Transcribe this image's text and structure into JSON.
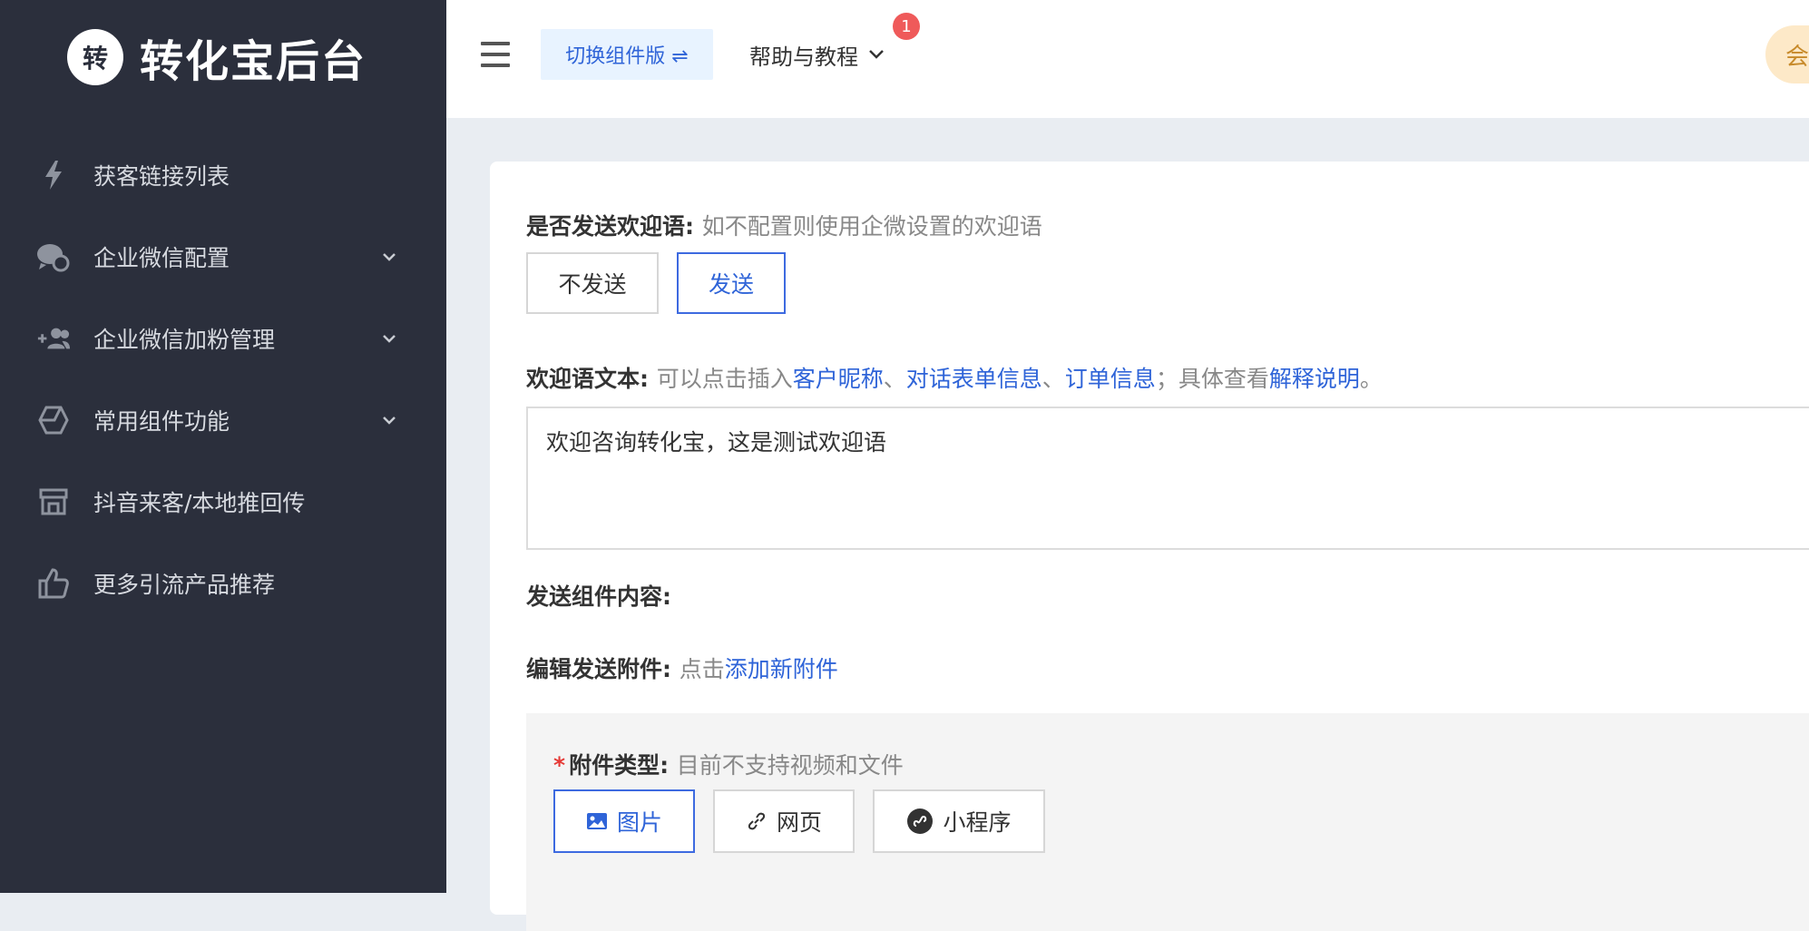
{
  "brand": {
    "logo_char": "转",
    "title": "转化宝后台"
  },
  "sidebar": {
    "items": [
      {
        "label": "获客链接列表",
        "icon": "lightning-icon",
        "has_children": false
      },
      {
        "label": "企业微信配置",
        "icon": "chat-bubbles-icon",
        "has_children": true
      },
      {
        "label": "企业微信加粉管理",
        "icon": "add-user-icon",
        "has_children": true
      },
      {
        "label": "常用组件功能",
        "icon": "hexagon-icon",
        "has_children": true
      },
      {
        "label": "抖音来客/本地推回传",
        "icon": "store-icon",
        "has_children": false
      },
      {
        "label": "更多引流产品推荐",
        "icon": "thumbs-up-icon",
        "has_children": false
      }
    ]
  },
  "topbar": {
    "switch_label": "切换组件版 ⇌",
    "help_label": "帮助与教程",
    "help_badge": "1",
    "avatar_char": "会"
  },
  "form": {
    "welcome_send": {
      "label": "是否发送欢迎语:",
      "hint": "如不配置则使用企微设置的欢迎语",
      "options": [
        "不发送",
        "发送"
      ],
      "selected": "发送"
    },
    "welcome_text": {
      "label": "欢迎语文本:",
      "hint_prefix": "可以点击插入",
      "link_nickname": "客户昵称",
      "sep1": "、",
      "link_form": "对话表单信息",
      "sep2": "、",
      "link_order": "订单信息",
      "hint_mid": "；具体查看",
      "link_explain": "解释说明",
      "hint_end": "。",
      "value": "欢迎咨询转化宝，这是测试欢迎语"
    },
    "component_content": {
      "label": "发送组件内容:"
    },
    "attachments": {
      "label": "编辑发送附件:",
      "hint": "点击",
      "link_add": "添加新附件"
    },
    "attachment_type": {
      "required_mark": "*",
      "label": "附件类型:",
      "hint": "目前不支持视频和文件",
      "options": [
        {
          "label": "图片",
          "icon": "image-icon"
        },
        {
          "label": "网页",
          "icon": "link-icon"
        },
        {
          "label": "小程序",
          "icon": "mini-program-icon"
        }
      ],
      "selected": "图片"
    }
  },
  "colors": {
    "sidebar_bg": "#2b2f3c",
    "accent": "#2f64d8",
    "badge": "#ef5a5a"
  }
}
